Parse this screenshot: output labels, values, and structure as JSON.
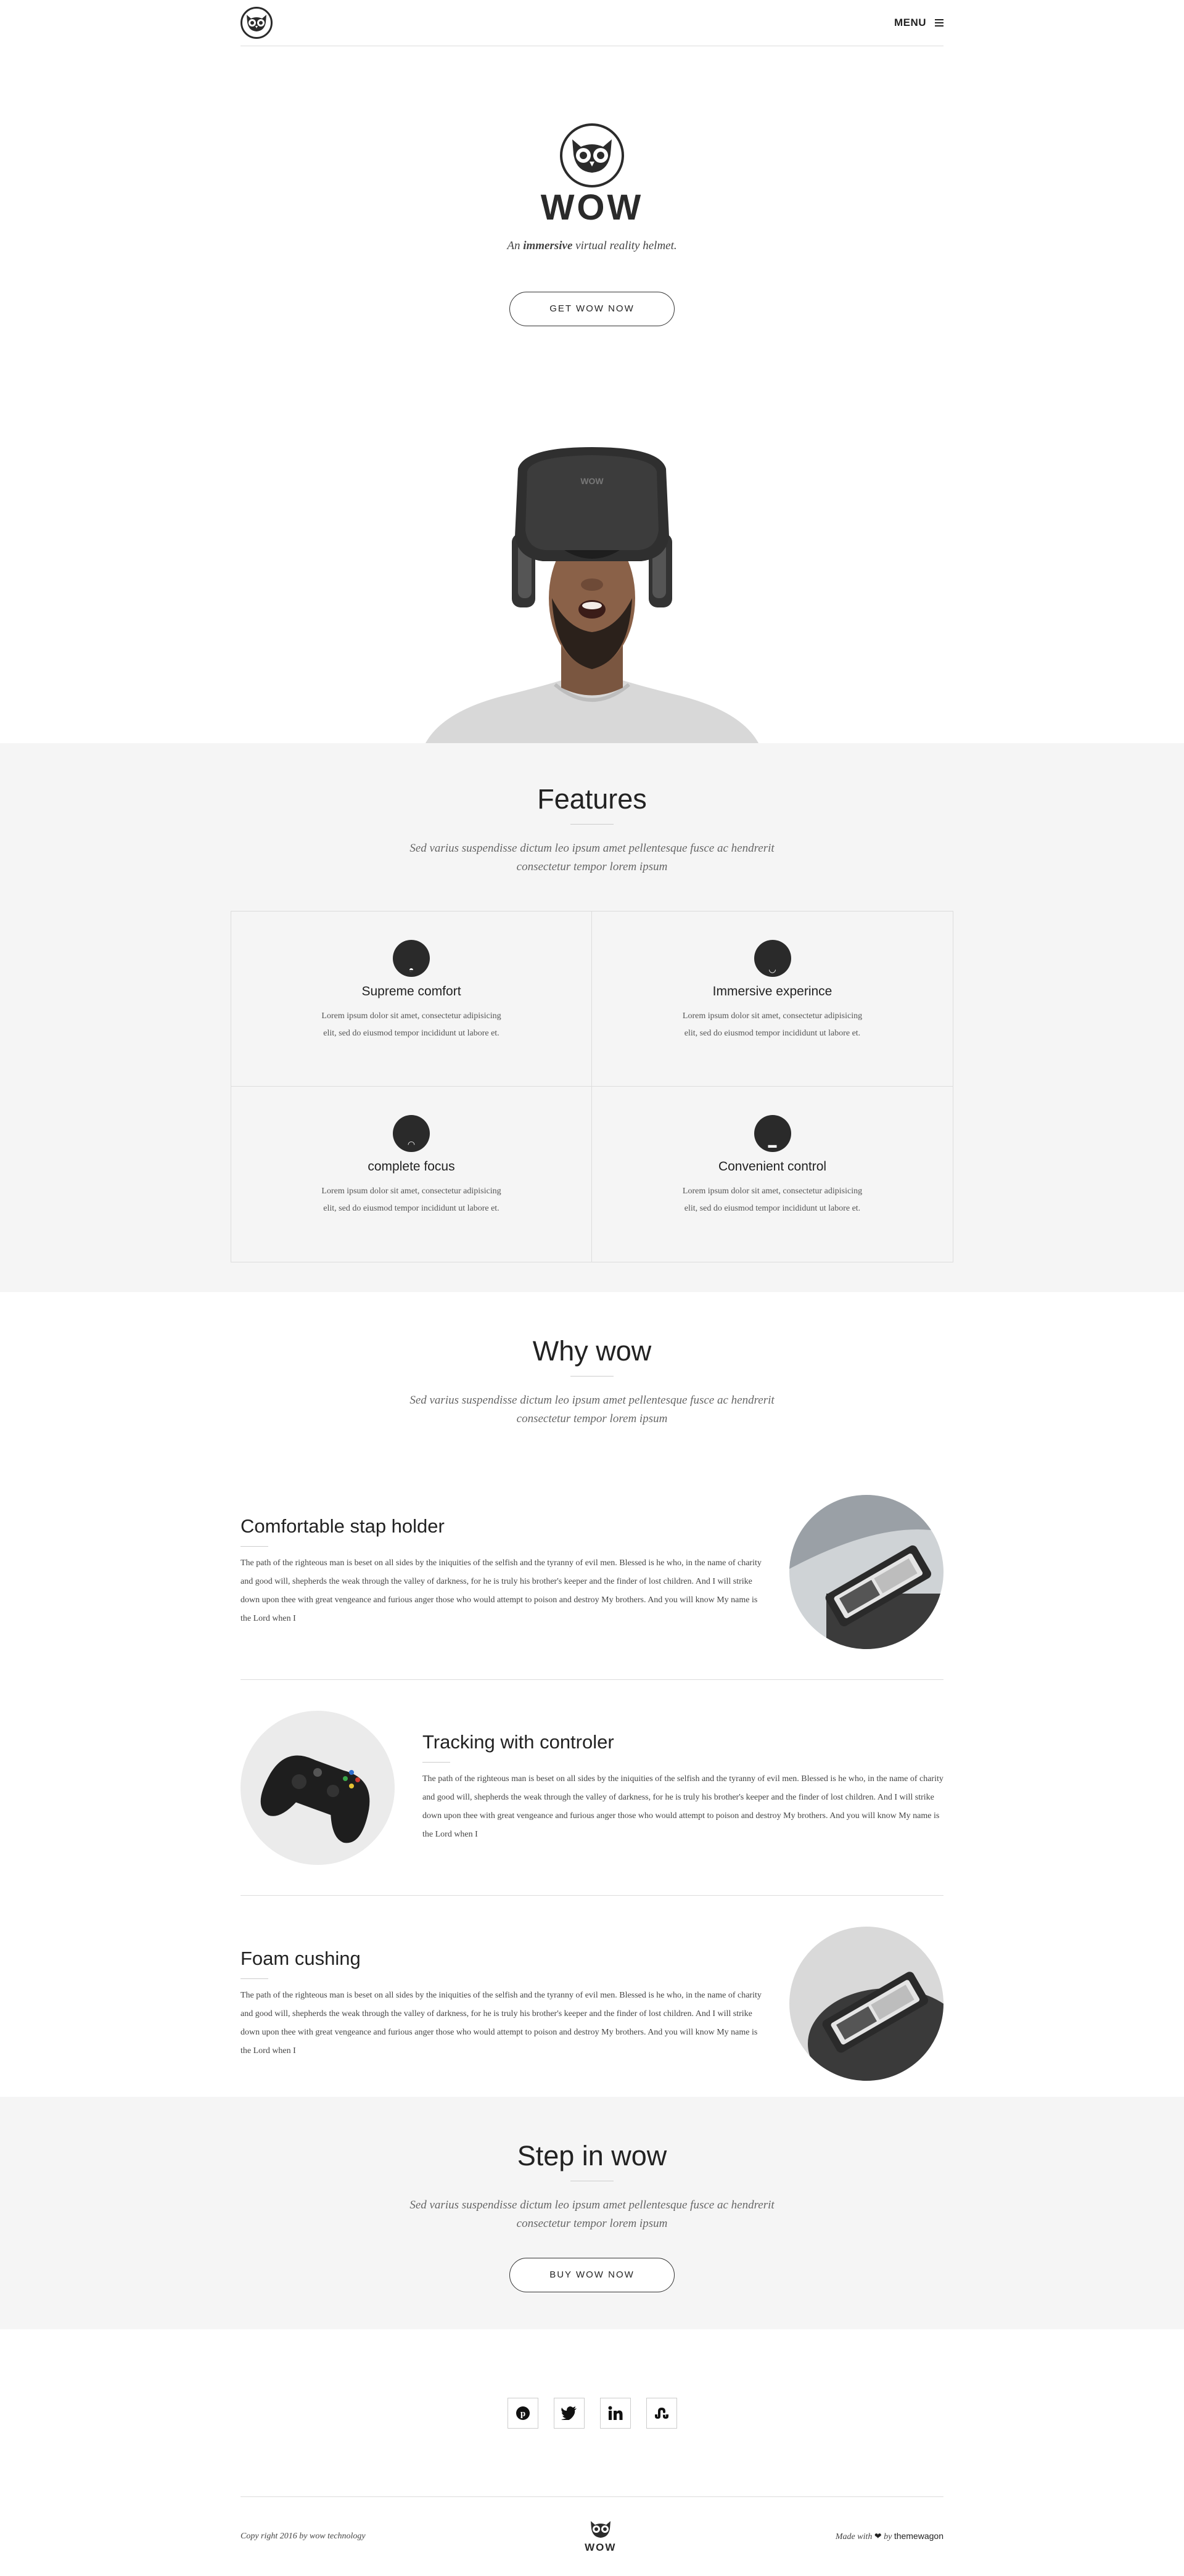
{
  "nav": {
    "menu_label": "MENU"
  },
  "hero": {
    "brand": "WOW",
    "tagline_pre": "An ",
    "tagline_bold": "immersive",
    "tagline_post": " virtual reality helmet.",
    "cta": "GET WOW NOW",
    "helmet_mark": "WOW"
  },
  "features": {
    "title": "Features",
    "subtitle": "Sed varius suspendisse dictum leo ipsum amet pellentesque fusce ac hendrerit consectetur tempor lorem ipsum",
    "items": [
      {
        "title": "Supreme comfort",
        "text": "Lorem ipsum dolor sit amet, consectetur adipisicing elit, sed do eiusmod tempor incididunt ut labore et.",
        "icon": "helmet-icon"
      },
      {
        "title": "Immersive experince",
        "text": "Lorem ipsum dolor sit amet, consectetur adipisicing elit, sed do eiusmod tempor incididunt ut labore et.",
        "icon": "face-icon"
      },
      {
        "title": "complete focus",
        "text": "Lorem ipsum dolor sit amet, consectetur adipisicing elit, sed do eiusmod tempor incididunt ut labore et.",
        "icon": "target-icon"
      },
      {
        "title": "Convenient control",
        "text": "Lorem ipsum dolor sit amet, consectetur adipisicing elit, sed do eiusmod tempor incididunt ut labore et.",
        "icon": "gamepad-icon"
      }
    ]
  },
  "why": {
    "title": "Why wow",
    "subtitle": "Sed varius suspendisse dictum leo ipsum amet pellentesque fusce ac hendrerit consectetur tempor lorem ipsum",
    "items": [
      {
        "title": "Comfortable stap holder",
        "text": "The path of the righteous man is beset on all sides by the iniquities of the selfish and the tyranny of evil men. Blessed is he who, in the name of charity and good will, shepherds the weak through the valley of darkness, for he is truly his brother's keeper and the finder of lost children. And I will strike down upon thee with great vengeance and furious anger those who would attempt to poison and destroy My brothers. And you will know My name is the Lord when I"
      },
      {
        "title": "Tracking with controler",
        "text": "The path of the righteous man is beset on all sides by the iniquities of the selfish and the tyranny of evil men. Blessed is he who, in the name of charity and good will, shepherds the weak through the valley of darkness, for he is truly his brother's keeper and the finder of lost children. And I will strike down upon thee with great vengeance and furious anger those who would attempt to poison and destroy My brothers. And you will know My name is the Lord when I"
      },
      {
        "title": "Foam cushing",
        "text": "The path of the righteous man is beset on all sides by the iniquities of the selfish and the tyranny of evil men. Blessed is he who, in the name of charity and good will, shepherds the weak through the valley of darkness, for he is truly his brother's keeper and the finder of lost children. And I will strike down upon thee with great vengeance and furious anger those who would attempt to poison and destroy My brothers. And you will know My name is the Lord when I"
      }
    ]
  },
  "step": {
    "title": "Step in wow",
    "subtitle": "Sed varius suspendisse dictum leo ipsum amet pellentesque fusce ac hendrerit consectetur tempor lorem ipsum",
    "cta": "BUY WOW NOW"
  },
  "social": [
    "pinterest-icon",
    "twitter-icon",
    "linkedin-icon",
    "stumbleupon-icon"
  ],
  "footer": {
    "copyright": "Copy right 2016 by wow technology",
    "brand": "WOW",
    "made_pre": "Made with",
    "made_by": "by",
    "made_link": "themewagon"
  }
}
